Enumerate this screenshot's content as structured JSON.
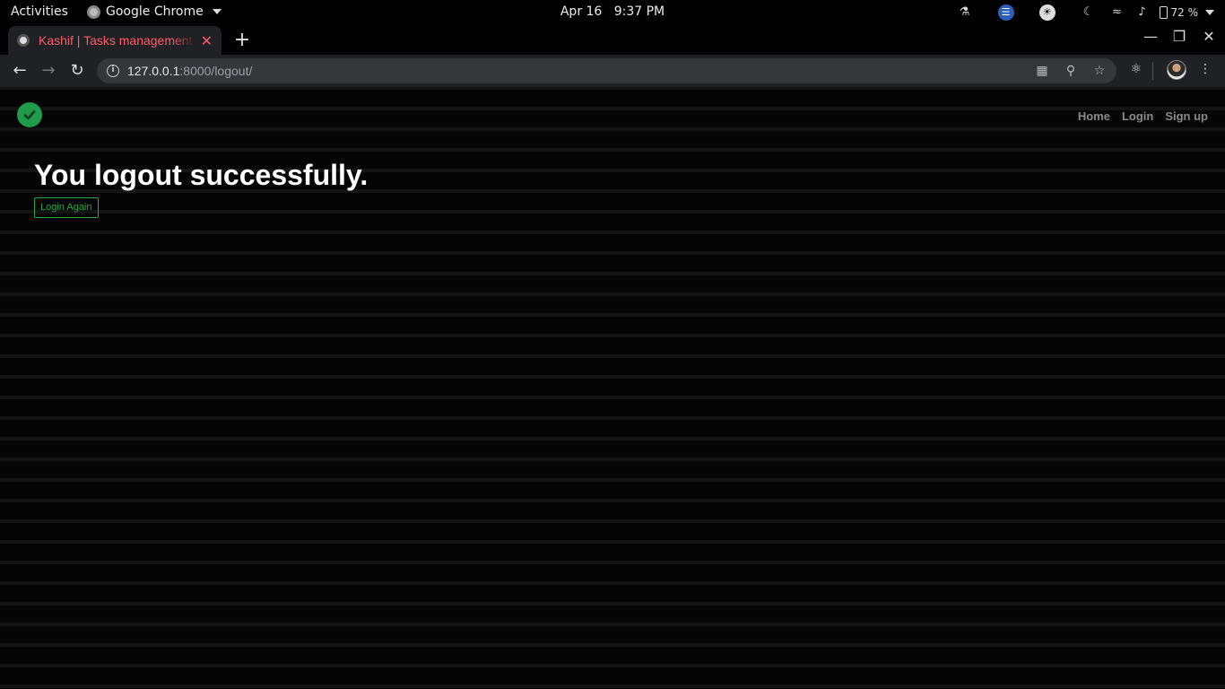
{
  "system_bar": {
    "activities": "Activities",
    "app_name": "Google Chrome",
    "date": "Apr 16",
    "time": "9:37 PM",
    "battery": "72 %",
    "tray_icons": [
      "accessibility-icon",
      "bluetooth-icon",
      "sync-icon",
      "night-light-icon",
      "wifi-icon",
      "volume-icon",
      "battery-icon"
    ]
  },
  "browser": {
    "tab_title": "Kashif | Tasks management",
    "url_host": "127.0.0.1",
    "url_rest": ":8000/logout/",
    "colors": {
      "tab_title": "#ff5a6a",
      "toolbar": "#202124",
      "omnibox": "#35363a"
    }
  },
  "page": {
    "nav": [
      "Home",
      "Login",
      "Sign up"
    ],
    "heading": "You logout successfully.",
    "login_again": "Login Again",
    "colors": {
      "accent": "#28a745",
      "logo": "#1f9b4a",
      "nav_link": "#8a8a8a"
    }
  }
}
